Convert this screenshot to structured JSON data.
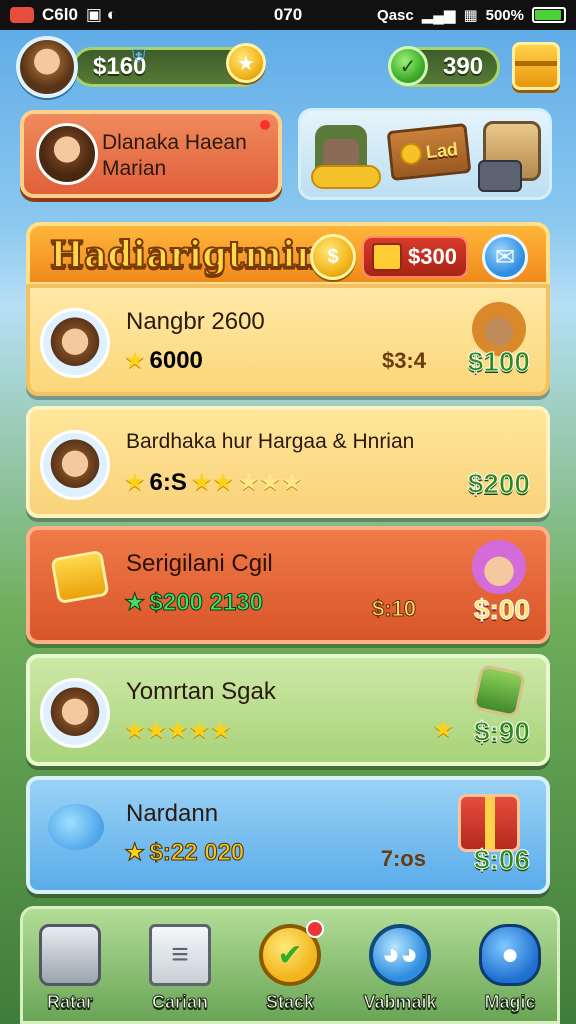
{
  "statusbar": {
    "left_text": "C6l0",
    "time": "070",
    "signal_text": "Qasc",
    "battery": "500%"
  },
  "topbar": {
    "money": "$160",
    "score": "390"
  },
  "profile": {
    "name": "Dlanaka Haean Marian"
  },
  "shop": {
    "sign": "Lad"
  },
  "offer": {
    "title": "Hadiarigtmin",
    "price": "$300"
  },
  "rows": [
    {
      "title": "Nangbr 2600",
      "sub": "6000",
      "old_price": "$3:4",
      "price": "$100"
    },
    {
      "title": "Bardhaka hur Hargaa & Hnrian",
      "sub": "6:S",
      "old_price": "",
      "price": "$200"
    },
    {
      "title": "Serigilani Cgil",
      "sub": "$200 2130",
      "old_price": "$:10",
      "price": "$:00"
    },
    {
      "title": "Yomrtan Sgak",
      "sub": "",
      "old_price": "",
      "price": "$:90"
    },
    {
      "title": "Nardann",
      "sub": "$:22 020",
      "old_price": "7:os",
      "price": "$:06"
    }
  ],
  "nav": [
    {
      "label": "Ratar"
    },
    {
      "label": "Carian"
    },
    {
      "label": "Stack"
    },
    {
      "label": "Vabmaik"
    },
    {
      "label": "Magic"
    }
  ]
}
